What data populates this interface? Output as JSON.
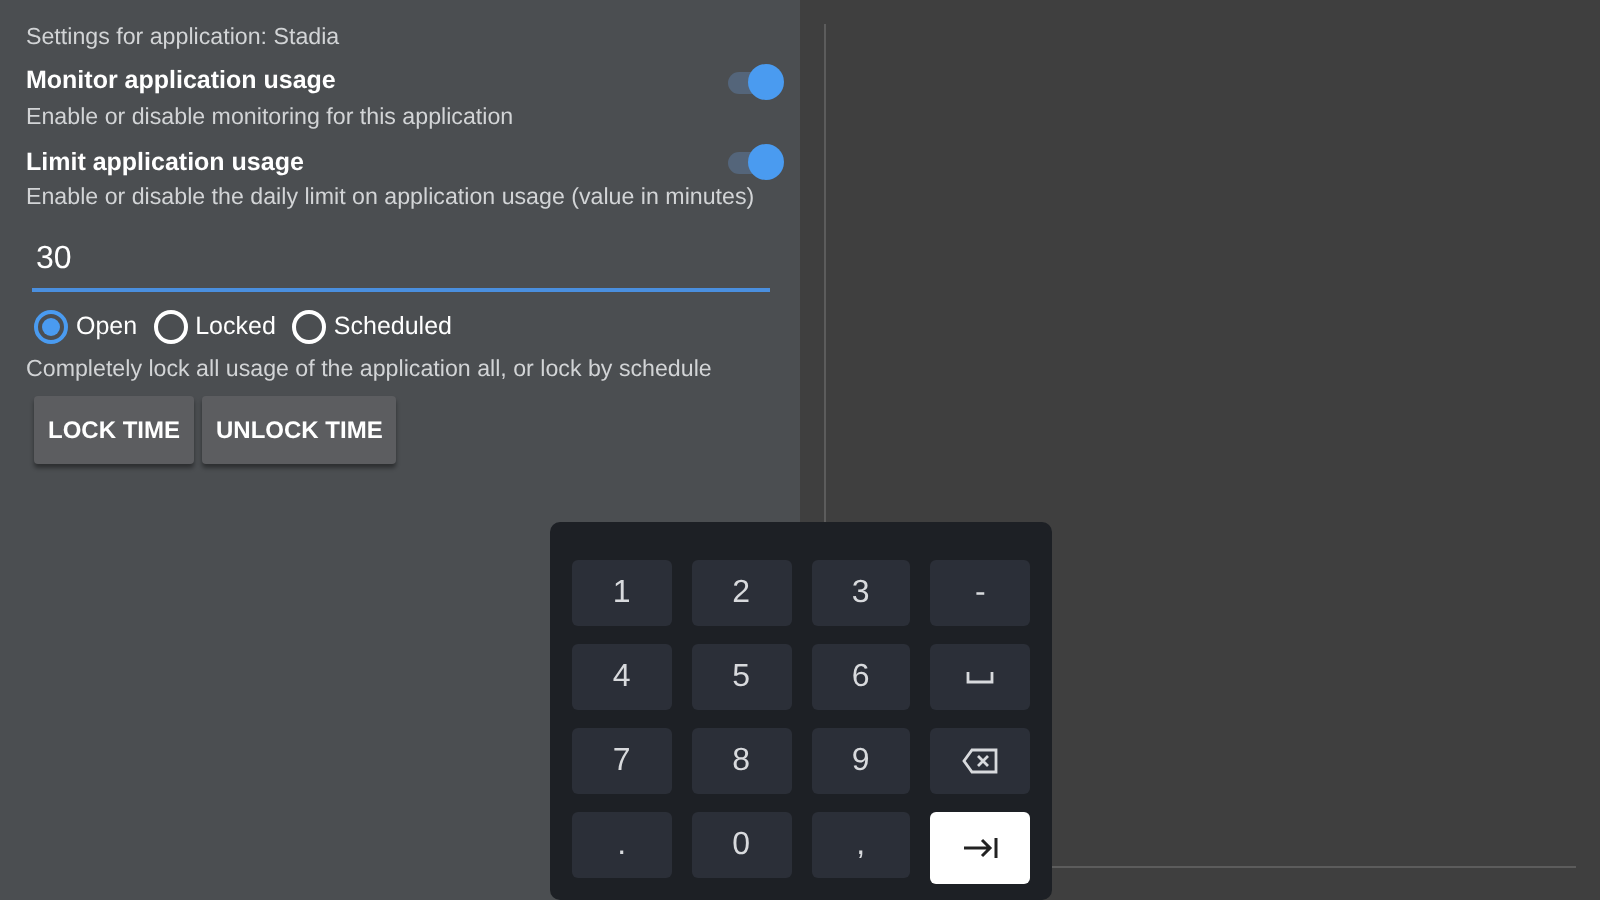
{
  "settings_title": "Settings for application: Stadia",
  "toggles": [
    {
      "label": "Monitor application usage",
      "description": "Enable or disable monitoring for this application",
      "on": true
    },
    {
      "label": "Limit application usage",
      "description": "Enable or disable the daily limit on application usage (value in minutes)",
      "on": true
    }
  ],
  "limit_field": {
    "value": "30"
  },
  "lock_mode": {
    "options": [
      {
        "label": "Open",
        "selected": true
      },
      {
        "label": "Locked",
        "selected": false
      },
      {
        "label": "Scheduled",
        "selected": false
      }
    ],
    "description": "Completely lock all usage of the application all, or lock by schedule"
  },
  "buttons": [
    "LOCK TIME",
    "UNLOCK TIME"
  ],
  "keypad": {
    "keys": [
      {
        "kind": "char",
        "label": "1",
        "selected": false
      },
      {
        "kind": "char",
        "label": "2",
        "selected": false
      },
      {
        "kind": "char",
        "label": "3",
        "selected": false
      },
      {
        "kind": "char",
        "label": "-",
        "selected": false
      },
      {
        "kind": "char",
        "label": "4",
        "selected": false
      },
      {
        "kind": "char",
        "label": "5",
        "selected": false
      },
      {
        "kind": "char",
        "label": "6",
        "selected": false
      },
      {
        "kind": "space",
        "selected": false
      },
      {
        "kind": "char",
        "label": "7",
        "selected": false
      },
      {
        "kind": "char",
        "label": "8",
        "selected": false
      },
      {
        "kind": "char",
        "label": "9",
        "selected": false
      },
      {
        "kind": "backspace",
        "selected": false
      },
      {
        "kind": "char",
        "label": ".",
        "selected": false
      },
      {
        "kind": "char",
        "label": "0",
        "selected": false
      },
      {
        "kind": "char",
        "label": ",",
        "selected": false
      },
      {
        "kind": "tab",
        "selected": true
      }
    ]
  }
}
